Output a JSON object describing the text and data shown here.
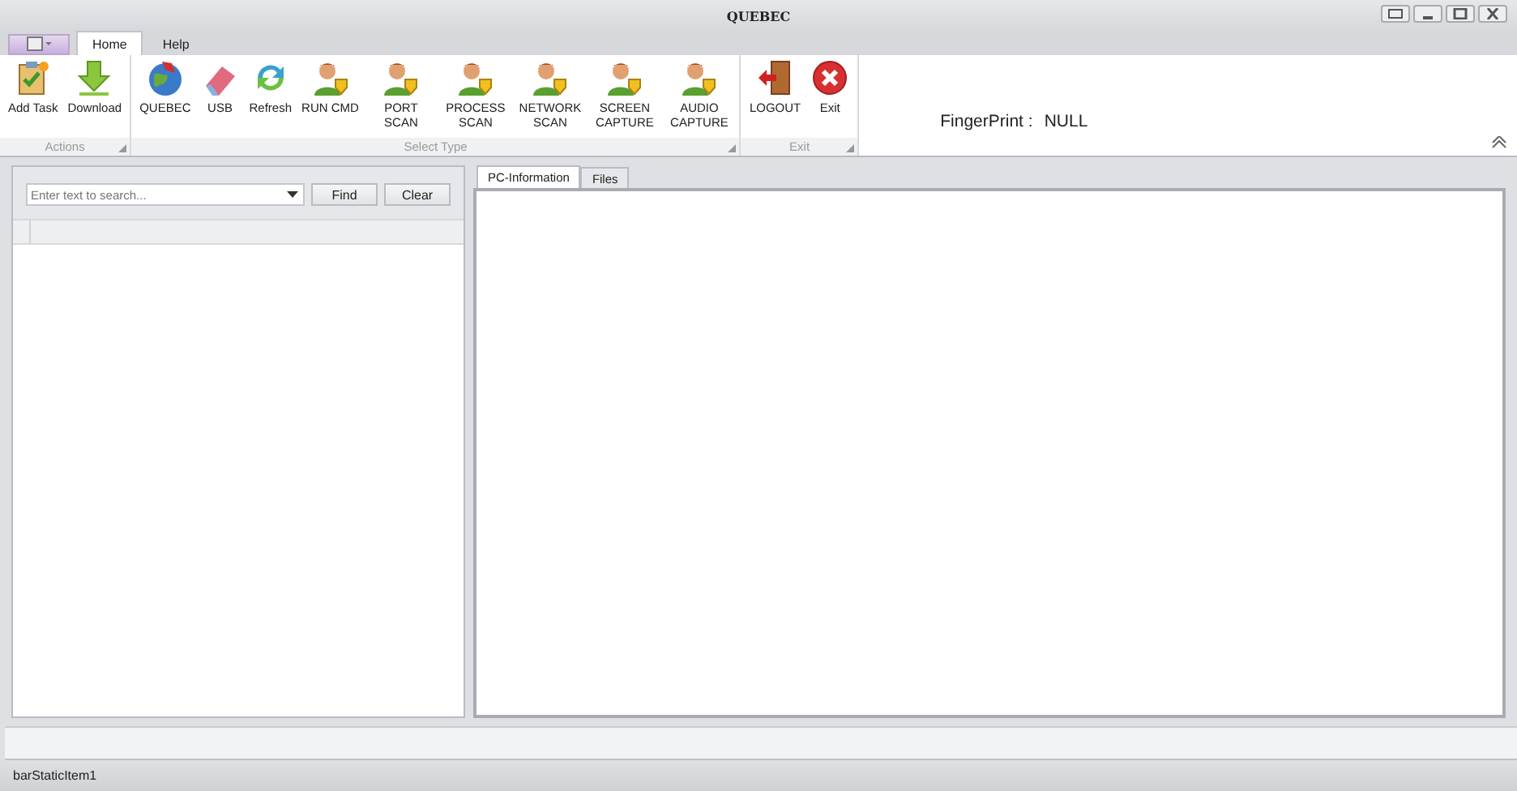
{
  "window": {
    "title": "QUEBEC"
  },
  "ribbon_tabs": [
    {
      "label": "Home",
      "selected": true
    },
    {
      "label": "Help",
      "selected": false
    }
  ],
  "ribbon_groups": [
    {
      "label": "Actions",
      "items": [
        {
          "label": "Add Task",
          "kind": "task"
        },
        {
          "label": "Download",
          "kind": "download"
        }
      ]
    },
    {
      "label": "Select Type",
      "items": [
        {
          "label": "QUEBEC",
          "kind": "globe"
        },
        {
          "label": "USB",
          "kind": "eraser"
        },
        {
          "label": "Refresh",
          "kind": "refresh"
        },
        {
          "label": "RUN CMD",
          "kind": "person"
        },
        {
          "label": "PORT SCAN",
          "kind": "person"
        },
        {
          "label": "PROCESS SCAN",
          "kind": "person"
        },
        {
          "label": "NETWORK SCAN",
          "kind": "person"
        },
        {
          "label": "SCREEN CAPTURE",
          "kind": "person"
        },
        {
          "label": "AUDIO CAPTURE",
          "kind": "person"
        }
      ]
    },
    {
      "label": "Exit",
      "items": [
        {
          "label": "LOGOUT",
          "kind": "door"
        },
        {
          "label": "Exit",
          "kind": "exit"
        }
      ]
    }
  ],
  "fingerprint": {
    "label": "FingerPrint :",
    "value": "NULL"
  },
  "search": {
    "placeholder": "Enter text to search...",
    "buttons": [
      "Find",
      "Clear"
    ]
  },
  "content_tabs": [
    {
      "label": "PC-Information",
      "selected": true
    },
    {
      "label": "Files",
      "selected": false
    }
  ],
  "status_bar": {
    "text": "barStaticItem1"
  }
}
